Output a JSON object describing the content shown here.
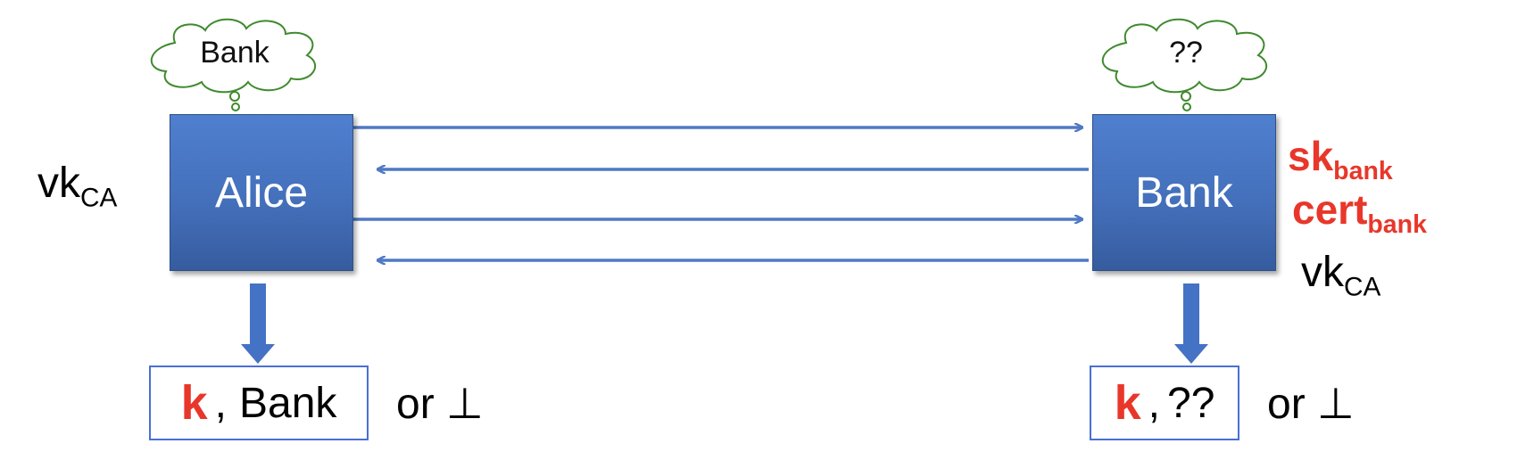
{
  "alice": {
    "name": "Alice",
    "thought": "Bank",
    "key_label": {
      "main": "vk",
      "sub": "CA"
    },
    "output": {
      "key": "k",
      "separator": ",",
      "identity": "Bank"
    },
    "or_label": "or ⊥"
  },
  "bank": {
    "name": "Bank",
    "thought": "??",
    "secret_key": {
      "main": "sk",
      "sub": "bank"
    },
    "certificate": {
      "main": "cert",
      "sub": "bank"
    },
    "key_label": {
      "main": "vk",
      "sub": "CA"
    },
    "output": {
      "key": "k",
      "separator": ",",
      "identity": "??"
    },
    "or_label": "or ⊥"
  },
  "colors": {
    "box_blue": "#4472c4",
    "arrow_blue": "#4f79c4",
    "secret_red": "#e8372a",
    "cloud_green": "#3f8a2e",
    "output_border": "#4a6fd4"
  },
  "messages": [
    {
      "direction": "alice-to-bank"
    },
    {
      "direction": "bank-to-alice"
    },
    {
      "direction": "alice-to-bank"
    },
    {
      "direction": "bank-to-alice"
    }
  ]
}
